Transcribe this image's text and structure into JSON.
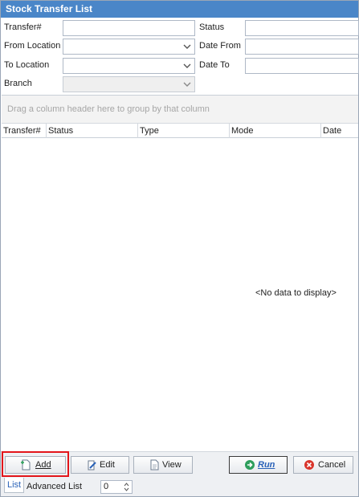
{
  "window": {
    "title": "Stock Transfer List"
  },
  "filters": {
    "transfer_no_label": "Transfer#",
    "transfer_no_value": "",
    "from_location_label": "From Location",
    "from_location_value": "",
    "to_location_label": "To Location",
    "to_location_value": "",
    "branch_label": "Branch",
    "branch_value": "",
    "status_label": "Status",
    "status_value": "",
    "date_from_label": "Date From",
    "date_from_value": "",
    "date_to_label": "Date To",
    "date_to_value": ""
  },
  "grid": {
    "group_hint": "Drag a column header here to group by that column",
    "columns": [
      "Transfer#",
      "Status",
      "Type",
      "Mode",
      "Date"
    ],
    "empty_text": "<No data to display>"
  },
  "buttons": {
    "add": "Add",
    "edit": "Edit",
    "view": "View",
    "run": "Run",
    "cancel": "Cancel"
  },
  "tabs": {
    "list": "List",
    "advanced": "Advanced List"
  },
  "spinner": {
    "value": "0"
  },
  "colors": {
    "title_bar": "#4a86c8",
    "run_text": "#2a62b8",
    "highlight": "#e3151a",
    "cancel_icon": "#d9352b",
    "run_icon": "#2e9e5c"
  }
}
